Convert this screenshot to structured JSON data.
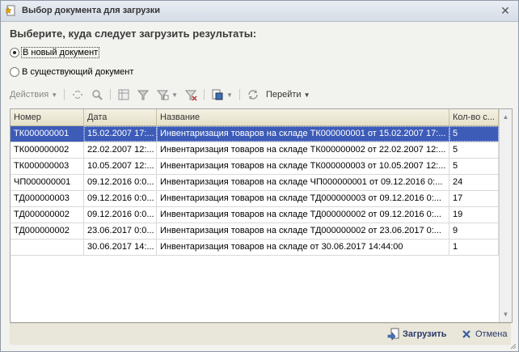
{
  "window": {
    "title": "Выбор документа для загрузки",
    "close_glyph": "✕"
  },
  "heading": "Выберите, куда следует загрузить результаты:",
  "options": [
    {
      "label": "В новый документ",
      "selected": true
    },
    {
      "label": "В существующий документ",
      "selected": false
    }
  ],
  "toolbar": {
    "actions_label": "Действия",
    "goto_label": "Перейти"
  },
  "table": {
    "columns": [
      "Номер",
      "Дата",
      "Название",
      "Кол-во с..."
    ],
    "rows": [
      [
        "ТК000000001",
        "15.02.2007 17:...",
        "Инвентаризация товаров на складе ТК000000001 от 15.02.2007 17:...",
        "5"
      ],
      [
        "ТК000000002",
        "22.02.2007 12:...",
        "Инвентаризация товаров на складе ТК000000002 от 22.02.2007 12:...",
        "5"
      ],
      [
        "ТК000000003",
        "10.05.2007 12:...",
        "Инвентаризация товаров на складе ТК000000003 от 10.05.2007 12:...",
        "5"
      ],
      [
        "ЧП000000001",
        "09.12.2016 0:0...",
        "Инвентаризация товаров на складе ЧП000000001 от 09.12.2016 0:...",
        "24"
      ],
      [
        "ТД000000003",
        "09.12.2016 0:0...",
        "Инвентаризация товаров на складе ТД000000003 от 09.12.2016 0:...",
        "17"
      ],
      [
        "ТД000000002",
        "09.12.2016 0:0...",
        "Инвентаризация товаров на складе ТД000000002 от 09.12.2016 0:...",
        "19"
      ],
      [
        "ТД000000002",
        "23.06.2017 0:0...",
        "Инвентаризация товаров на складе ТД000000002 от 23.06.2017 0:...",
        "9"
      ],
      [
        "",
        "30.06.2017 14:...",
        "Инвентаризация товаров на складе  от 30.06.2017 14:44:00",
        "1"
      ]
    ]
  },
  "buttons": {
    "load_label": "Загрузить",
    "cancel_label": "Отмена"
  },
  "colors": {
    "selection": "#3d5cb8",
    "window_bg": "#f2f2ee"
  }
}
